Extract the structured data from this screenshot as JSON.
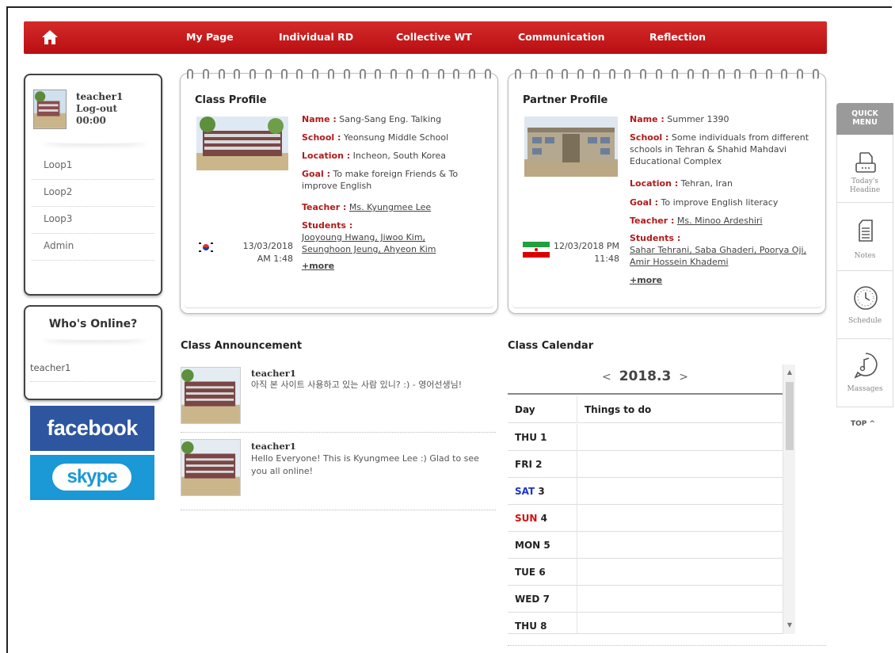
{
  "nav": {
    "items": [
      "My Page",
      "Individual RD",
      "Collective WT",
      "Communication",
      "Reflection"
    ],
    "color": "#c01a1c"
  },
  "user": {
    "name": "teacher1",
    "logout": "Log-out",
    "timer": "00:00",
    "loops": [
      "Loop1",
      "Loop2",
      "Loop3",
      "Admin"
    ]
  },
  "online": {
    "title": "Who's Online?",
    "users": [
      "teacher1"
    ]
  },
  "social": {
    "facebook": "facebook",
    "skype": "skype"
  },
  "class_profile": {
    "title": "Class Profile",
    "name_label": "Name :",
    "name": "Sang-Sang Eng. Talking",
    "school_label": "School :",
    "school": "Yeonsung Middle School",
    "location_label": "Location :",
    "location": "Incheon, South Korea",
    "goal_label": "Goal :",
    "goal": "To make foreign Friends & To improve English",
    "teacher_label": "Teacher :",
    "teacher": "Ms. Kyungmee Lee",
    "students_label": "Students :",
    "students": "Jooyoung Hwang, Jiwoo Kim, Seunghoon Jeung, Ahyeon Kim",
    "more": "+more",
    "date": "13/03/2018",
    "time": "AM 1:48"
  },
  "partner_profile": {
    "title": "Partner Profile",
    "name_label": "Name :",
    "name": "Summer 1390",
    "school_label": "School :",
    "school": "Some individuals from different schools in Tehran & Shahid Mahdavi Educational Complex",
    "location_label": "Location :",
    "location": "Tehran, Iran",
    "goal_label": "Goal :",
    "goal": "To improve English literacy",
    "teacher_label": "Teacher :",
    "teacher": "Ms. Minoo Ardeshiri",
    "students_label": "Students :",
    "students": "Sahar Tehrani, Saba Ghaderi, Poorya Oji, Amir Hossein Khademi",
    "more": "+more",
    "date": "12/03/2018 PM",
    "time": "11:48"
  },
  "announcement": {
    "title": "Class Announcement",
    "posts": [
      {
        "author": "teacher1",
        "text": "아직 본 사이트 사용하고 있는 사람 있니? :) - 영어선생님!"
      },
      {
        "author": "teacher1",
        "text": "Hello Everyone! This is Kyungmee Lee :) Glad to see you all online!"
      }
    ]
  },
  "calendar": {
    "title": "Class Calendar",
    "month": "2018.3",
    "prev": "<",
    "next": ">",
    "col_day": "Day",
    "col_todo": "Things to do",
    "days": [
      {
        "dow": "THU",
        "num": "1"
      },
      {
        "dow": "FRI",
        "num": "2"
      },
      {
        "dow": "SAT",
        "num": "3"
      },
      {
        "dow": "SUN",
        "num": "4"
      },
      {
        "dow": "MON",
        "num": "5"
      },
      {
        "dow": "TUE",
        "num": "6"
      },
      {
        "dow": "WED",
        "num": "7"
      },
      {
        "dow": "THU",
        "num": "8"
      }
    ]
  },
  "quick_menu": {
    "title_line1": "QUICK",
    "title_line2": "MENU",
    "items": [
      {
        "line1": "Today's",
        "line2": "Headine",
        "icon": "printer-icon"
      },
      {
        "line1": "Notes",
        "line2": "",
        "icon": "notes-icon"
      },
      {
        "line1": "Schedule",
        "line2": "",
        "icon": "clock-icon"
      },
      {
        "line1": "Massages",
        "line2": "",
        "icon": "music-note-icon"
      }
    ],
    "top": "TOP ^"
  }
}
